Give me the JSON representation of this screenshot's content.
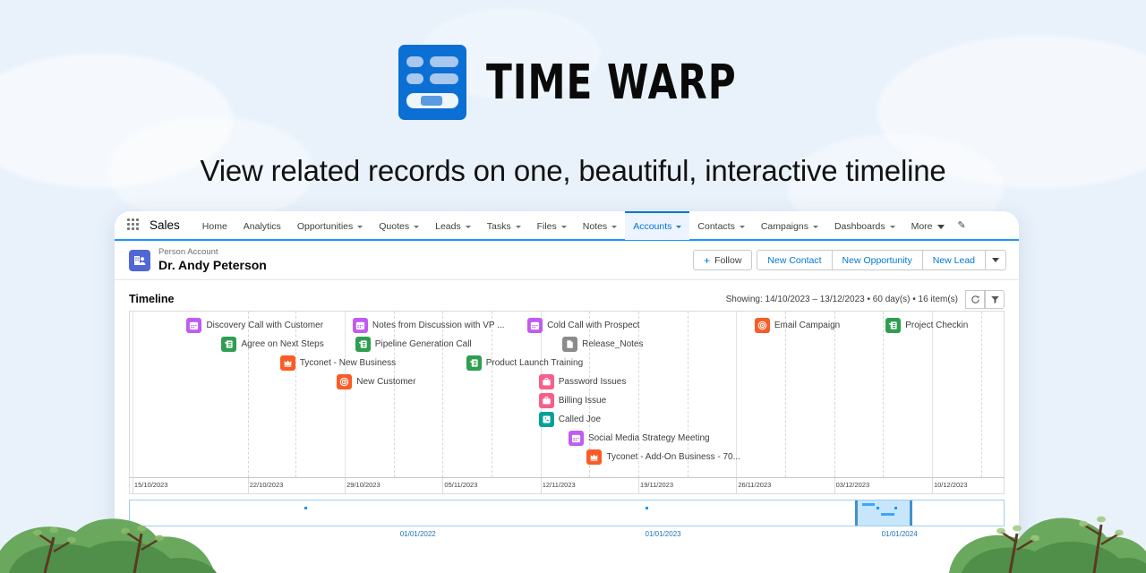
{
  "brand": {
    "wordmark": "TIME WARP",
    "logo_icon": "timeline-slider-logo-icon",
    "accent": "#0b6fd4",
    "tagline": "View related records on one, beautiful, interactive timeline"
  },
  "nav": {
    "app_launcher_icon": "app-launcher-grid-icon",
    "app_name": "Sales",
    "items": [
      {
        "label": "Home",
        "caret": false,
        "active": false
      },
      {
        "label": "Analytics",
        "caret": false,
        "active": false
      },
      {
        "label": "Opportunities",
        "caret": true,
        "active": false
      },
      {
        "label": "Quotes",
        "caret": true,
        "active": false
      },
      {
        "label": "Leads",
        "caret": true,
        "active": false
      },
      {
        "label": "Tasks",
        "caret": true,
        "active": false
      },
      {
        "label": "Files",
        "caret": true,
        "active": false
      },
      {
        "label": "Notes",
        "caret": true,
        "active": false
      },
      {
        "label": "Accounts",
        "caret": true,
        "active": true
      },
      {
        "label": "Contacts",
        "caret": true,
        "active": false
      },
      {
        "label": "Campaigns",
        "caret": true,
        "active": false
      },
      {
        "label": "Dashboards",
        "caret": true,
        "active": false
      }
    ],
    "more_label": "More",
    "edit_icon": "pencil-icon"
  },
  "record": {
    "avatar_icon": "person-account-icon",
    "type": "Person Account",
    "name": "Dr. Andy Peterson",
    "follow_label": "Follow",
    "follow_icon": "plus-icon",
    "actions": [
      "New Contact",
      "New Opportunity",
      "New Lead"
    ],
    "overflow_icon": "chevron-down-icon"
  },
  "timeline": {
    "title": "Timeline",
    "status": "Showing: 14/10/2023 – 13/12/2023 • 60 day(s) • 16 item(s)",
    "refresh_icon": "refresh-icon",
    "filter_icon": "filter-icon",
    "colors": {
      "event": "#c05cf0",
      "task": "#2e9e4f",
      "opportunity": "#fa5c26",
      "campaign": "#fa5c26",
      "file": "#8b8b8b",
      "case": "#f5608a",
      "call": "#04a09a"
    },
    "items": [
      {
        "label": "Discovery Call with Customer",
        "icon": "event-icon",
        "type": "event",
        "x": 6.5,
        "row": 0
      },
      {
        "label": "Notes from Discussion with VP ...",
        "icon": "event-icon",
        "type": "event",
        "x": 25.5,
        "row": 0
      },
      {
        "label": "Cold Call with Prospect",
        "icon": "event-icon",
        "type": "event",
        "x": 45.5,
        "row": 0
      },
      {
        "label": "Email Campaign",
        "icon": "campaign-icon",
        "type": "campaign",
        "x": 71.5,
        "row": 0
      },
      {
        "label": "Project Checkin",
        "icon": "task-icon",
        "type": "task",
        "x": 86.5,
        "row": 0
      },
      {
        "label": "Agree on Next Steps",
        "icon": "task-icon",
        "type": "task",
        "x": 10.5,
        "row": 1
      },
      {
        "label": "Pipeline Generation Call",
        "icon": "task-icon",
        "type": "task",
        "x": 25.8,
        "row": 1
      },
      {
        "label": "Release_Notes",
        "icon": "file-icon",
        "type": "file",
        "x": 49.5,
        "row": 1
      },
      {
        "label": "Tyconet - New Business",
        "icon": "opportunity-icon",
        "type": "opportunity",
        "x": 17.2,
        "row": 2
      },
      {
        "label": "Product Launch Training",
        "icon": "task-icon",
        "type": "task",
        "x": 38.5,
        "row": 2
      },
      {
        "label": "New Customer",
        "icon": "campaign-icon",
        "type": "campaign",
        "x": 23.7,
        "row": 3
      },
      {
        "label": "Password Issues",
        "icon": "case-icon",
        "type": "case",
        "x": 46.8,
        "row": 3
      },
      {
        "label": "Billing Issue",
        "icon": "case-icon",
        "type": "case",
        "x": 46.8,
        "row": 4
      },
      {
        "label": "Called Joe",
        "icon": "call-icon",
        "type": "call",
        "x": 46.8,
        "row": 5
      },
      {
        "label": "Social Media Strategy Meeting",
        "icon": "event-icon",
        "type": "event",
        "x": 50.2,
        "row": 6
      },
      {
        "label": "Tyconet - Add-On Business - 70...",
        "icon": "opportunity-icon",
        "type": "opportunity",
        "x": 52.3,
        "row": 7
      }
    ],
    "axis_ticks": [
      {
        "label": "15/10/2023",
        "x": 0.3
      },
      {
        "label": "22/10/2023",
        "x": 13.5
      },
      {
        "label": "29/10/2023",
        "x": 24.6
      },
      {
        "label": "05/11/2023",
        "x": 35.8
      },
      {
        "label": "12/11/2023",
        "x": 47.0
      },
      {
        "label": "19/11/2023",
        "x": 58.2
      },
      {
        "label": "26/11/2023",
        "x": 69.4
      },
      {
        "label": "03/12/2023",
        "x": 80.6
      },
      {
        "label": "10/12/2023",
        "x": 91.8
      }
    ]
  },
  "scrubber": {
    "ticks": [
      {
        "label": "01/01/2022",
        "x": 33.0
      },
      {
        "label": "01/01/2023",
        "x": 61.0
      },
      {
        "label": "01/01/2024",
        "x": 88.0
      }
    ],
    "selection": {
      "left": 83.0,
      "width": 6.6
    },
    "dots": [
      20.0,
      59.0,
      85.5,
      87.5
    ]
  }
}
